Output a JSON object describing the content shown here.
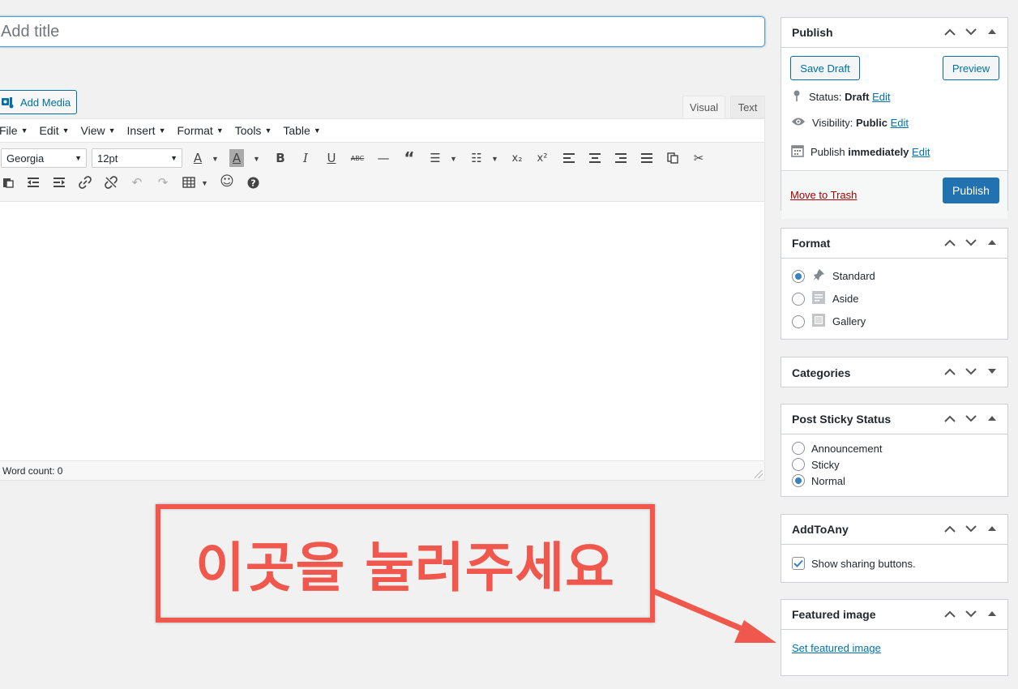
{
  "title": {
    "placeholder": "Add title"
  },
  "add_media": {
    "label": "Add Media"
  },
  "tabs": {
    "visual": "Visual",
    "text": "Text"
  },
  "menubar": [
    {
      "label": "File"
    },
    {
      "label": "Edit"
    },
    {
      "label": "View"
    },
    {
      "label": "Insert"
    },
    {
      "label": "Format"
    },
    {
      "label": "Tools"
    },
    {
      "label": "Table"
    }
  ],
  "toolbar": {
    "font_family": "Georgia",
    "font_size": "12pt"
  },
  "statusbar": {
    "word_count": "Word count: 0"
  },
  "publish": {
    "title": "Publish",
    "save_draft": "Save Draft",
    "preview": "Preview",
    "status_label": "Status:",
    "status_value": "Draft",
    "visibility_label": "Visibility:",
    "visibility_value": "Public",
    "publish_label": "Publish",
    "publish_value": "immediately",
    "edit": "Edit",
    "move_to_trash": "Move to Trash",
    "publish_button": "Publish"
  },
  "format": {
    "title": "Format",
    "options": [
      "Standard",
      "Aside",
      "Gallery"
    ],
    "selected": "Standard"
  },
  "categories": {
    "title": "Categories"
  },
  "sticky": {
    "title": "Post Sticky Status",
    "options": [
      "Announcement",
      "Sticky",
      "Normal"
    ],
    "selected": "Normal"
  },
  "addtoany": {
    "title": "AddToAny",
    "show_sharing": "Show sharing buttons."
  },
  "featured": {
    "title": "Featured image",
    "set_link": "Set featured image"
  },
  "annotation": {
    "text": "이곳을 눌러주세요"
  },
  "colors": {
    "accent": "#2271b1",
    "annotation": "#f0584d",
    "trash": "#aa0000"
  }
}
